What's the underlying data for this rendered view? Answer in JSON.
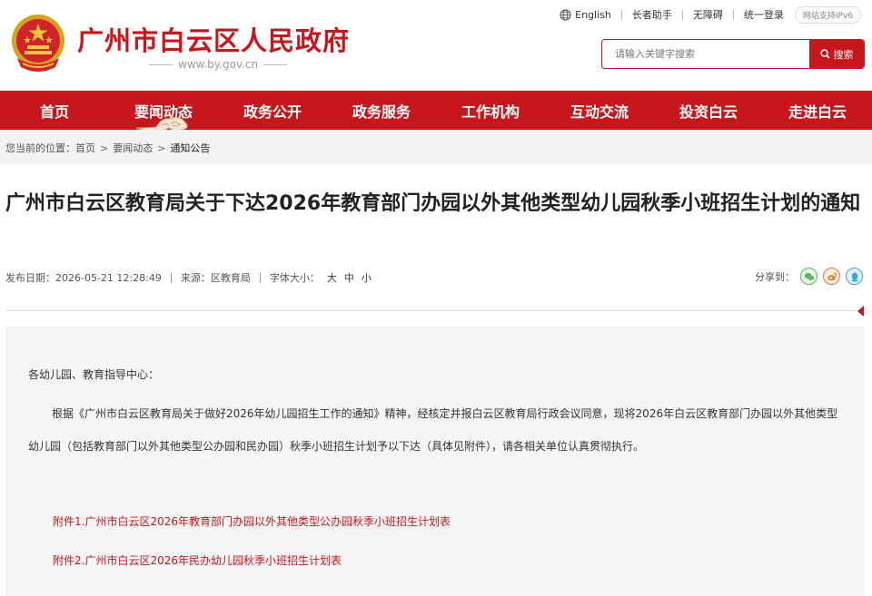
{
  "header": {
    "site_title": "广州市白云区人民政府",
    "domain": "www.by.gov.cn",
    "links": [
      "English",
      "长者助手",
      "无障碍",
      "统一登录"
    ],
    "ipv6": "网站支持IPv6"
  },
  "search": {
    "placeholder": "请输入关键字搜索",
    "button_label": "搜索"
  },
  "nav": {
    "items": [
      "首页",
      "要闻动态",
      "政务公开",
      "政务服务",
      "工作机构",
      "互动交流",
      "投资白云",
      "走进白云"
    ]
  },
  "breadcrumb": {
    "prefix": "您当前的位置：",
    "items": [
      "首页",
      "要闻动态",
      "通知公告"
    ]
  },
  "article": {
    "title": "广州市白云区教育局关于下达2026年教育部门办园以外其他类型幼儿园秋季小班招生计划的通知",
    "publish_date": "发布日期：2026-05-21 12:28:49",
    "source": "来源：区教育局",
    "font_size_label": "字体大小：",
    "font_sizes": [
      "大",
      "中",
      "小"
    ],
    "share_label": "分享到：",
    "salutation": "各幼儿园、教育指导中心：",
    "body": "根据《广州市白云区教育局关于做好2026年幼儿园招生工作的通知》精神，经核定并报白云区教育局行政会议同意，现将2026年白云区教育部门办园以外其他类型幼儿园（包括教育部门以外其他类型公办园和民办园）秋季小班招生计划予以下达（具体见附件），请各相关单位认真贯彻执行。",
    "attachments": [
      "附件1.广州市白云区2026年教育部门办园以外其他类型公办园秋季小班招生计划表",
      "附件2.广州市白云区2026年民办幼儿园秋季小班招生计划表"
    ]
  },
  "colors": {
    "brand_red": "#c8161d",
    "wechat": "#5bb85d",
    "weibo": "#e8762d",
    "qq": "#3aa0e8"
  },
  "icons": [
    "national-emblem-icon",
    "globe-icon",
    "search-icon",
    "cloud-decoration-icon",
    "wechat-icon",
    "weibo-icon",
    "qq-icon"
  ]
}
